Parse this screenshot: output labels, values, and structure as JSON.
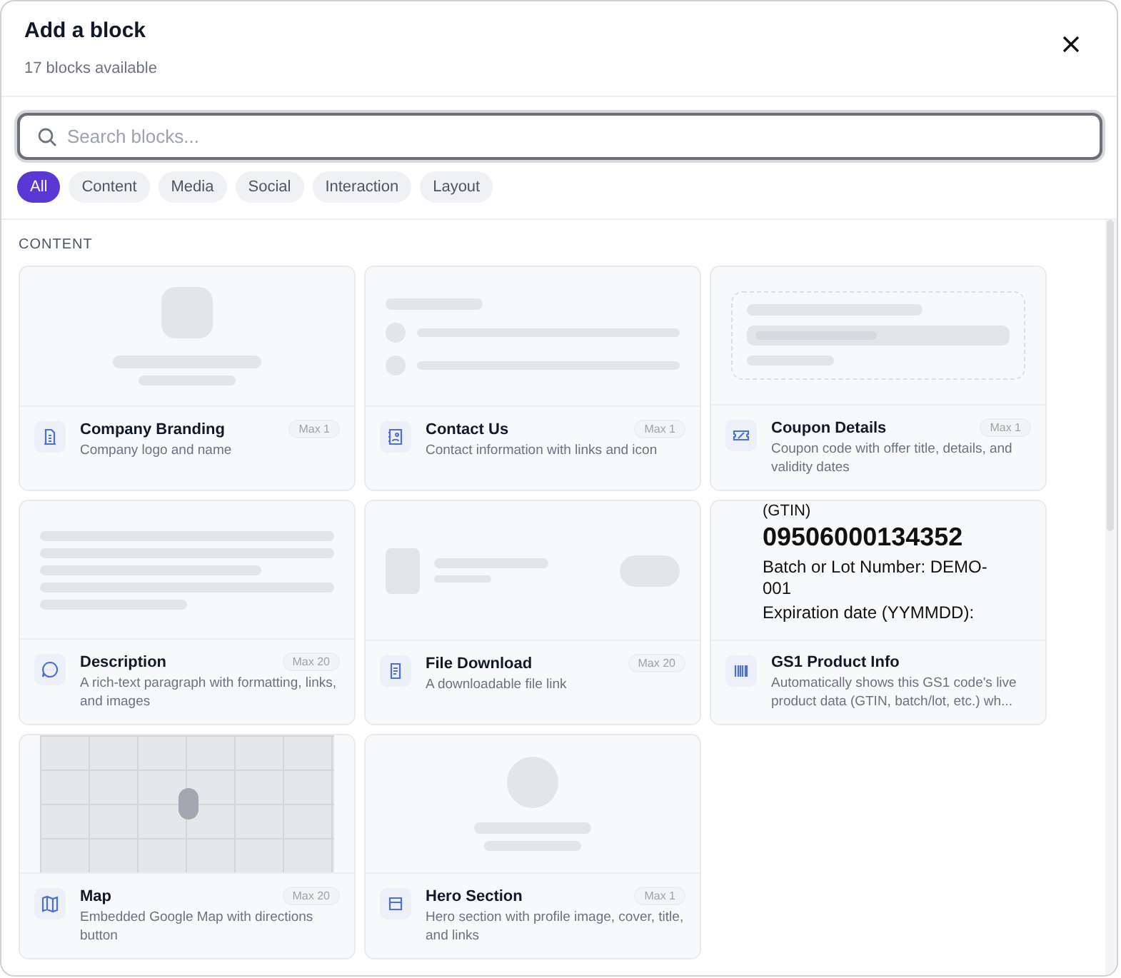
{
  "dialog": {
    "title": "Add a block",
    "subtitle": "17 blocks available"
  },
  "search": {
    "placeholder": "Search blocks..."
  },
  "filters": [
    {
      "label": "All",
      "selected": true
    },
    {
      "label": "Content",
      "selected": false
    },
    {
      "label": "Media",
      "selected": false
    },
    {
      "label": "Social",
      "selected": false
    },
    {
      "label": "Interaction",
      "selected": false
    },
    {
      "label": "Layout",
      "selected": false
    }
  ],
  "section": {
    "heading": "CONTENT"
  },
  "blocks": [
    {
      "kind": "branding",
      "name": "Company Branding",
      "description": "Company logo and name",
      "limit": "Max 1"
    },
    {
      "kind": "contact",
      "name": "Contact Us",
      "description": "Contact information with links and icon",
      "limit": "Max 1"
    },
    {
      "kind": "coupon",
      "name": "Coupon Details",
      "description": "Coupon code with offer title, details, and validity dates",
      "limit": "Max 1"
    },
    {
      "kind": "description",
      "name": "Description",
      "description": "A rich-text paragraph with formatting, links, and images",
      "limit": "Max 20"
    },
    {
      "kind": "file",
      "name": "File Download",
      "description": "A downloadable file link",
      "limit": "Max 20"
    },
    {
      "kind": "gs1",
      "name": "GS1 Product Info",
      "description": "Automatically shows this GS1 code's live product data (GTIN, batch/lot, etc.) wh...",
      "preview": {
        "label": "(GTIN)",
        "code": "09506000134352",
        "lines": [
          "Batch or Lot Number: DEMO-001",
          "Expiration date (YYMMDD):"
        ]
      }
    },
    {
      "kind": "map",
      "name": "Map",
      "description": "Embedded Google Map with directions button",
      "limit": "Max 20"
    },
    {
      "kind": "hero",
      "name": "Hero Section",
      "description": "Hero section with profile image, cover, title, and links",
      "limit": "Max 1"
    }
  ]
}
